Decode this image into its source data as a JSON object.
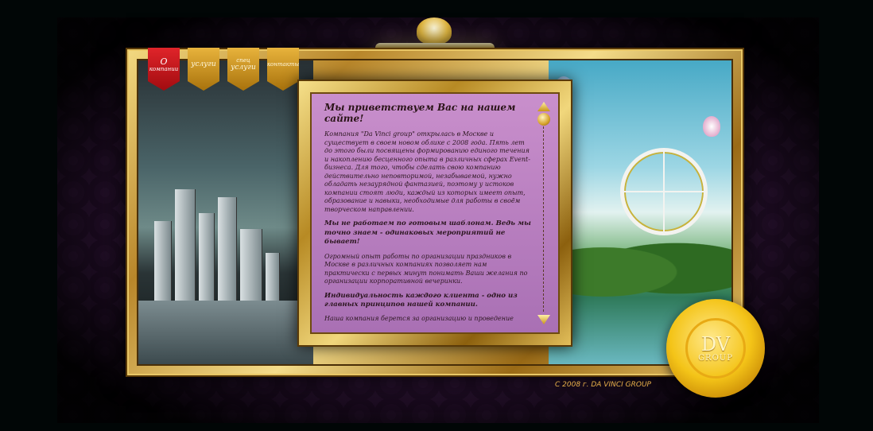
{
  "nav": {
    "tabs": [
      {
        "line1": "О",
        "line2": "компании",
        "active": true
      },
      {
        "line1": "",
        "line2": "услуги",
        "active": false
      },
      {
        "line1": "спец",
        "line2": "услуги",
        "active": false
      },
      {
        "line1": "",
        "line2": "контакты",
        "active": false
      }
    ]
  },
  "content": {
    "heading": "Мы приветствуем Вас на нашем сайте!",
    "paragraphs": [
      "Компания \"Da Vinci group\" открылась в Москве и существует в своем новом облике с 2008 года. Пять лет до этого были посвящены формированию единого течения и накоплению бесценного опыта в различных сферах Event-бизнеса. Для того, чтобы сделать свою компанию действительно неповторимой, незабываемой, нужно обладать незаурядной фантазией, поэтому у истоков компании стоят люди, каждый из которых имеет опыт, образование и навыки, необходимые для работы в своём творческом направлении.",
      "Мы не работаем по готовым шаблонам. Ведь мы точно знаем - одинаковых мероприятий не бывает!",
      "Огромный опыт работы по организации праздников в Москве в различных компаниях позволяет нам практически с первых минут понимать Ваши желания по организации корпоративной вечеринки.",
      "Индивидуальность каждого клиента - одно из главных принципов нашей компании.",
      "Наша компания берется за организацию и проведение"
    ]
  },
  "seal": {
    "monogram": "DV",
    "word": "GROUP"
  },
  "footer": {
    "copyright": "С 2008 г. DA VINCI GROUP"
  },
  "colors": {
    "accent_gold": "#e8b33c",
    "active_tab": "#d41c22",
    "panel_bg": "#c28ac6",
    "footer_text": "#e8b04a"
  },
  "icons": [
    "scroll-up-arrow-icon",
    "scroll-down-arrow-icon",
    "lamp-icon",
    "wax-seal-icon"
  ]
}
